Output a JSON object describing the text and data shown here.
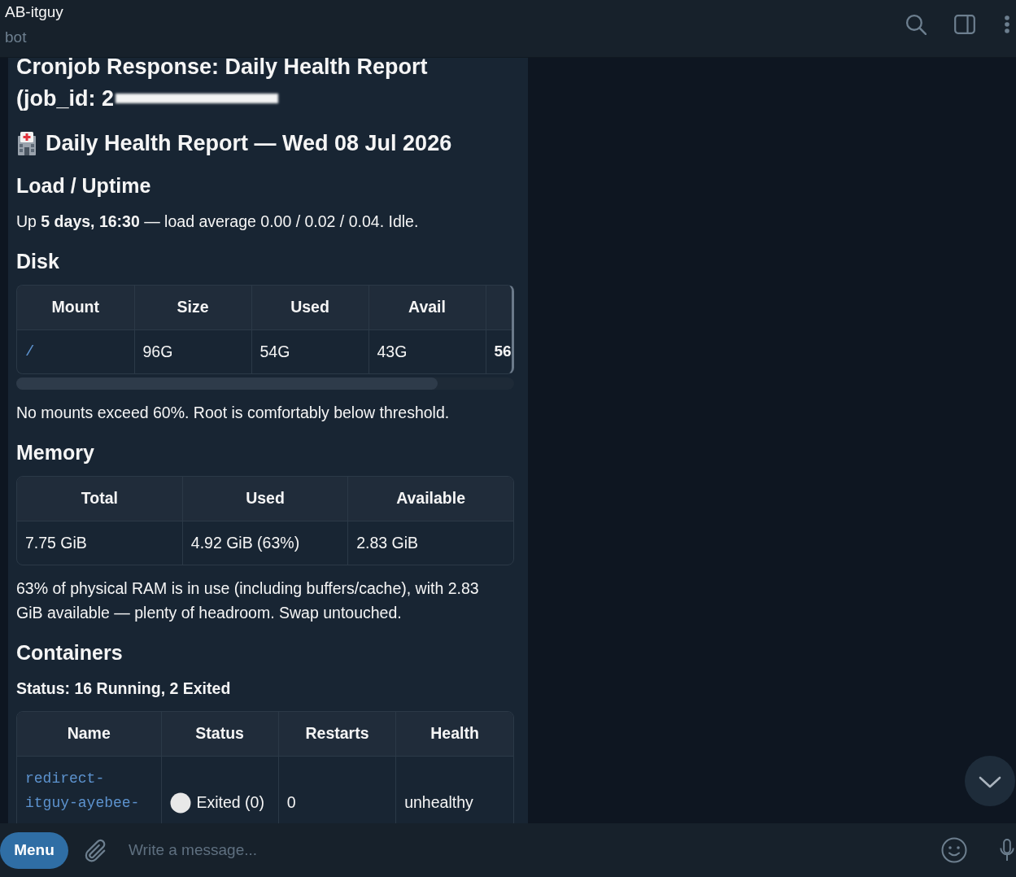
{
  "header": {
    "title": "AB-itguy",
    "subtitle": "bot"
  },
  "message": {
    "title_lines": [
      "Cronjob Response: Daily Health Report",
      "(job_id: 2"
    ],
    "job_id_redacted": true,
    "report_title": "Daily Health Report — Wed 08 Jul 2026",
    "blocks": [
      {
        "kind": "heading",
        "text": "Load / Uptime"
      },
      {
        "kind": "paragraph",
        "text": "Up **5 days, 16:30** — load average 0.00 / 0.02 / 0.04. Idle.",
        "bold": false
      },
      {
        "kind": "heading",
        "text": "Disk"
      },
      {
        "kind": "table",
        "scrollable": true,
        "columns": [
          "Mount",
          "Size",
          "Used",
          "Avail"
        ],
        "rows": [
          [
            {
              "kind": "link",
              "text": "/"
            },
            {
              "kind": "text",
              "text": "96G"
            },
            {
              "kind": "text",
              "text": "54G"
            },
            {
              "kind": "text",
              "text": "43G"
            },
            {
              "kind": "bold",
              "text": "56"
            }
          ]
        ]
      },
      {
        "kind": "paragraph",
        "text": "No mounts exceed 60%. Root is comfortably below threshold.",
        "bold": false
      },
      {
        "kind": "heading",
        "text": "Memory"
      },
      {
        "kind": "table",
        "scrollable": false,
        "columns": [
          "Total",
          "Used",
          "Available"
        ],
        "rows": [
          [
            {
              "kind": "text",
              "text": "7.75 GiB"
            },
            {
              "kind": "text",
              "text": "4.92 GiB (63%)"
            },
            {
              "kind": "text",
              "text": "2.83 GiB"
            }
          ]
        ]
      },
      {
        "kind": "paragraph",
        "text": "63% of physical RAM is in use (including buffers/cache), with 2.83 GiB available — plenty of headroom. Swap untouched.",
        "bold": false
      },
      {
        "kind": "heading",
        "text": "Containers"
      },
      {
        "kind": "paragraph",
        "text": "Status: 16 Running, 2 Exited",
        "bold": true
      },
      {
        "kind": "table",
        "scrollable": false,
        "columns": [
          "Name",
          "Status",
          "Restarts",
          "Health"
        ],
        "rows": [
          [
            {
              "kind": "code",
              "text": "redirect-itguy-ayebee-"
            },
            {
              "kind": "status",
              "text": "Exited (0)",
              "color": "#e8e8e8"
            },
            {
              "kind": "text",
              "text": "0"
            },
            {
              "kind": "text",
              "text": "unhealthy"
            }
          ]
        ]
      }
    ]
  },
  "composer": {
    "menu_button": "Menu",
    "placeholder": "Write a message..."
  }
}
